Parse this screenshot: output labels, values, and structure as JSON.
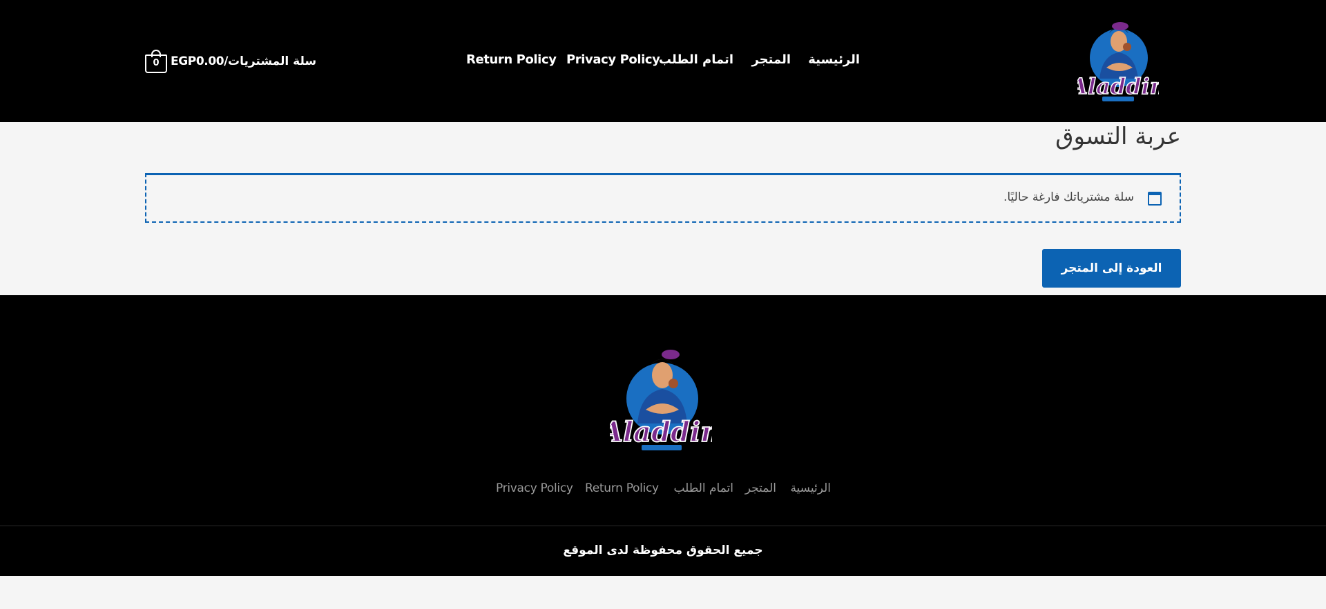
{
  "header": {
    "logo_alt": "Aladdin",
    "nav": {
      "home": "الرئيسية",
      "shop": "المتجر",
      "checkout": "اتمام الطلب",
      "privacy": "Privacy Policy",
      "return_policy": "Return Policy"
    },
    "cart": {
      "label": "سلة المشتريات",
      "separator": "/",
      "total": "EGP0.00",
      "count": "0"
    }
  },
  "main": {
    "title": "عربة التسوق",
    "notice_icon": "window-icon",
    "empty_message": "سلة مشترياتك فارغة حاليًا.",
    "return_button_label": "العودة إلى المتجر"
  },
  "footer": {
    "logo_alt": "Aladdin",
    "links": {
      "home": "الرئيسية",
      "shop": "المتجر",
      "checkout": "اتمام الطلب",
      "return_policy": "Return Policy",
      "privacy": "Privacy Policy"
    },
    "copyright": "جميع الحقوق محفوظة لدى الموقع"
  },
  "colors": {
    "header_bg": "#000000",
    "accent_blue": "#0c63b3",
    "page_bg": "#f5f5f5",
    "logo_purple": "#7b2a8c"
  }
}
